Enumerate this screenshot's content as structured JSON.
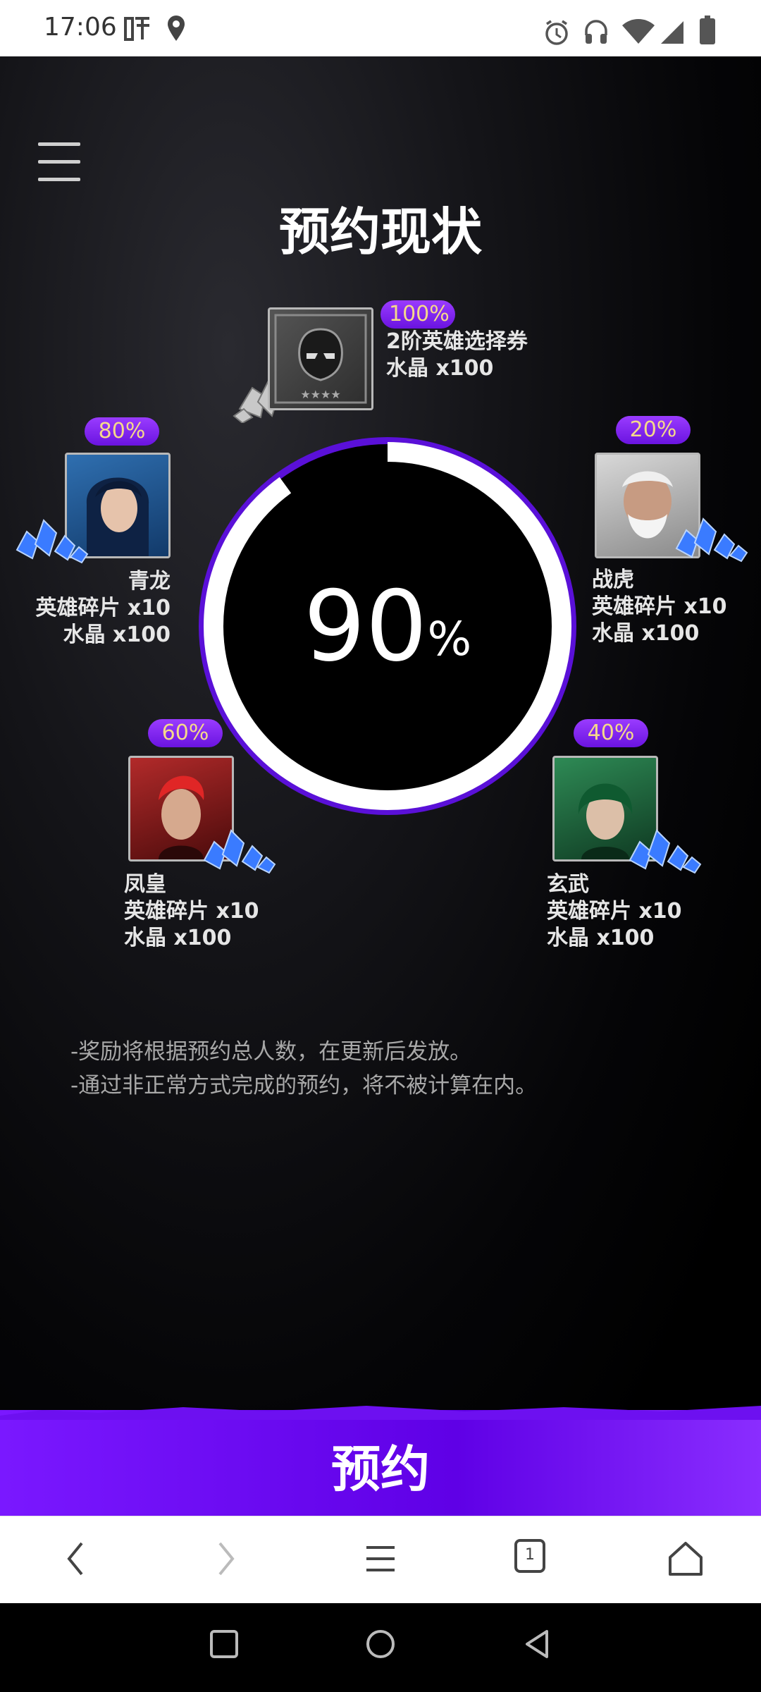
{
  "status_bar": {
    "time": "17:06",
    "left_icons": [
      "listen-app-icon",
      "location-pin-icon"
    ],
    "right_icons": [
      "alarm-icon",
      "headset-icon",
      "wifi-icon",
      "signal-icon",
      "battery-icon"
    ]
  },
  "page": {
    "title": "预约现状",
    "progress": {
      "value": "90",
      "unit": "%",
      "fraction": 0.9
    },
    "top_reward": {
      "percent": "100%",
      "line1": "2阶英雄选择券",
      "line2": "水晶 x100"
    },
    "heroes": [
      {
        "id": "qinglong",
        "percent": "80%",
        "name": "青龙",
        "line2": "英雄碎片 x10",
        "line3": "水晶 x100"
      },
      {
        "id": "zhanhu",
        "percent": "20%",
        "name": "战虎",
        "line2": "英雄碎片 x10",
        "line3": "水晶 x100"
      },
      {
        "id": "fenghuang",
        "percent": "60%",
        "name": "凤皇",
        "line2": "英雄碎片 x10",
        "line3": "水晶 x100"
      },
      {
        "id": "xuanwu",
        "percent": "40%",
        "name": "玄武",
        "line2": "英雄碎片 x10",
        "line3": "水晶 x100"
      }
    ],
    "notes": [
      "-奖励将根据预约总人数，在更新后发放。",
      "-通过非正常方式完成的预约，将不被计算在内。"
    ],
    "cta_label": "预约"
  },
  "browser_bar": {
    "icons": [
      "back-icon",
      "forward-icon",
      "menu-icon",
      "tabs-icon",
      "home-icon"
    ],
    "tab_count": "1"
  },
  "nav_bar": {
    "icons": [
      "recents-icon",
      "home-circle-icon",
      "back-triangle-icon"
    ]
  },
  "colors": {
    "accent": "#6a14e0",
    "badge_text": "#f5d98a",
    "background": "#000000"
  }
}
